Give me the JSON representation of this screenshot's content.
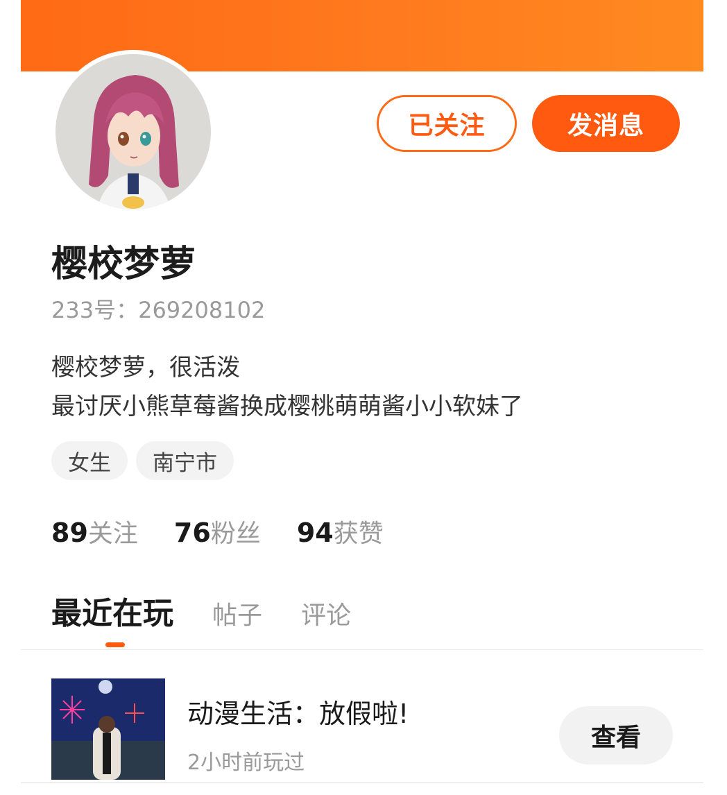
{
  "header": {
    "follow_button": "已关注",
    "message_button": "发消息"
  },
  "profile": {
    "name": "樱校梦萝",
    "id_text": "233号：269208102",
    "bio_line1": "樱校梦萝，很活泼",
    "bio_line2": "最讨厌小熊草莓酱换成樱桃萌萌酱小小软妹了",
    "tags": [
      "女生",
      "南宁市"
    ]
  },
  "stats": [
    {
      "number": "89",
      "label": "关注"
    },
    {
      "number": "76",
      "label": "粉丝"
    },
    {
      "number": "94",
      "label": "获赞"
    }
  ],
  "tabs": [
    {
      "label": "最近在玩",
      "active": true
    },
    {
      "label": "帖子",
      "active": false
    },
    {
      "label": "评论",
      "active": false
    }
  ],
  "recent_game": {
    "title": "动漫生活：放假啦!",
    "subtitle": "2小时前玩过",
    "view_button": "查看"
  },
  "colors": {
    "accent": "#ff5a10",
    "banner": "#ff7a1e"
  },
  "icons": {
    "avatar": "anime-girl-avatar-image",
    "game_thumbnail": "fireworks-night-scene-image"
  }
}
